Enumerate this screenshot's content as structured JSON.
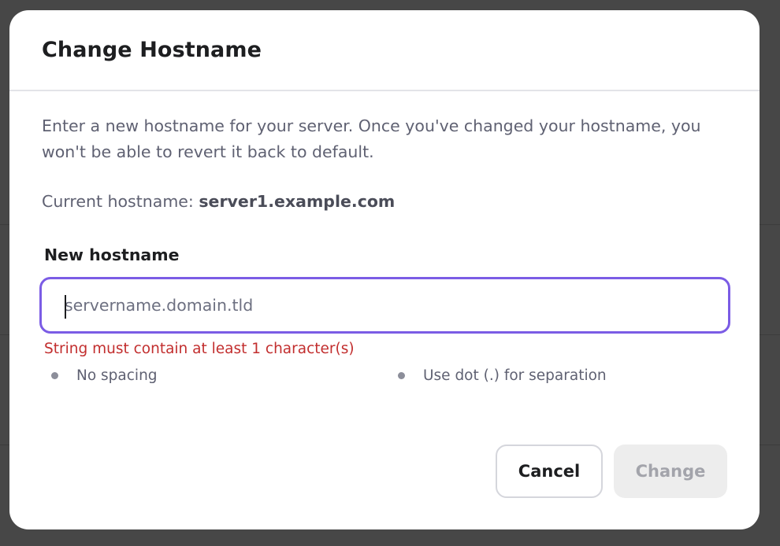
{
  "dialog": {
    "title": "Change Hostname",
    "description": "Enter a new hostname for your server. Once you've changed your hostname, you won't be able to revert it back to default.",
    "current_label": "Current hostname:",
    "current_value": "server1.example.com",
    "field_label": "New hostname",
    "input_value": "",
    "input_placeholder": "servername.domain.tld",
    "error": "String must contain at least 1 character(s)",
    "rules": [
      "No spacing",
      "Use dot (.) for separation"
    ],
    "cancel_label": "Cancel",
    "change_label": "Change"
  },
  "colors": {
    "accent": "#7b5ce5",
    "error": "#c22e2e",
    "disabled_bg": "#ededed"
  }
}
